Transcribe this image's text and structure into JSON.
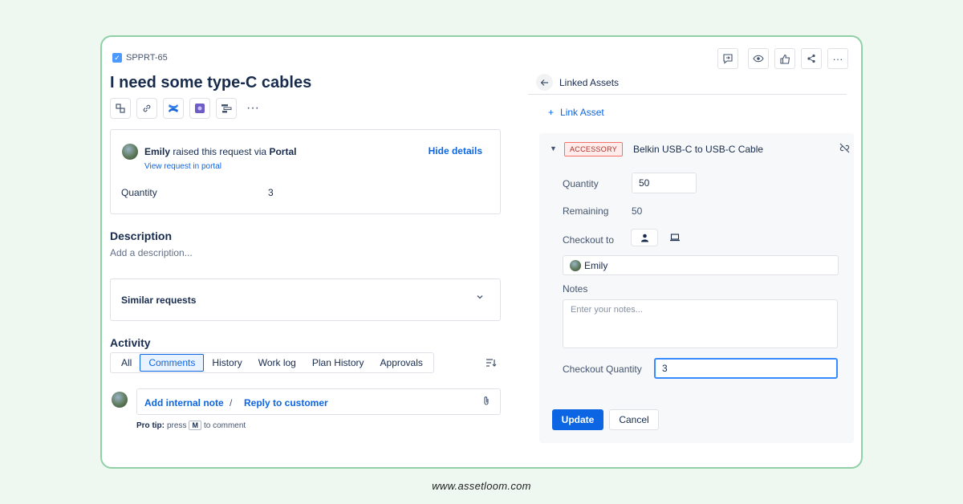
{
  "issue": {
    "key": "SPPRT-65",
    "title": "I need some type-C cables"
  },
  "toolbar": {
    "icons": [
      "subtask-icon",
      "link-icon",
      "confluence-icon",
      "app-icon",
      "roadmap-icon",
      "more-icon"
    ],
    "more": "···"
  },
  "request": {
    "requester": "Emily",
    "raised_text": "raised this request via",
    "channel": "Portal",
    "view_link": "View request in portal",
    "hide_details": "Hide details",
    "quantity_label": "Quantity",
    "quantity_value": "3"
  },
  "description": {
    "heading": "Description",
    "placeholder": "Add a description..."
  },
  "similar": {
    "label": "Similar requests"
  },
  "activity": {
    "heading": "Activity",
    "tabs": [
      "All",
      "Comments",
      "History",
      "Work log",
      "Plan History",
      "Approvals"
    ],
    "active_tab": "Comments",
    "add_internal_note": "Add internal note",
    "separator": "/",
    "reply_to_customer": "Reply to customer",
    "protip_label": "Pro tip:",
    "protip_press": "press",
    "protip_key": "M",
    "protip_rest": "to comment"
  },
  "linked_assets": {
    "title": "Linked Assets",
    "link_asset": "Link Asset",
    "asset": {
      "category": "ACCESSORY",
      "name": "Belkin USB-C to USB-C Cable",
      "quantity_label": "Quantity",
      "quantity_value": "50",
      "remaining_label": "Remaining",
      "remaining_value": "50",
      "checkout_to_label": "Checkout to",
      "checkout_to_value": "Emily",
      "notes_label": "Notes",
      "notes_placeholder": "Enter your notes...",
      "checkout_qty_label": "Checkout Quantity",
      "checkout_qty_value": "3"
    },
    "update_label": "Update",
    "cancel_label": "Cancel"
  },
  "footer": {
    "url": "www.assetloom.com"
  },
  "colors": {
    "accent": "#0c66e4",
    "frame": "#8fd0a6",
    "background": "#eef8f1",
    "badge": "#ae2e24"
  }
}
